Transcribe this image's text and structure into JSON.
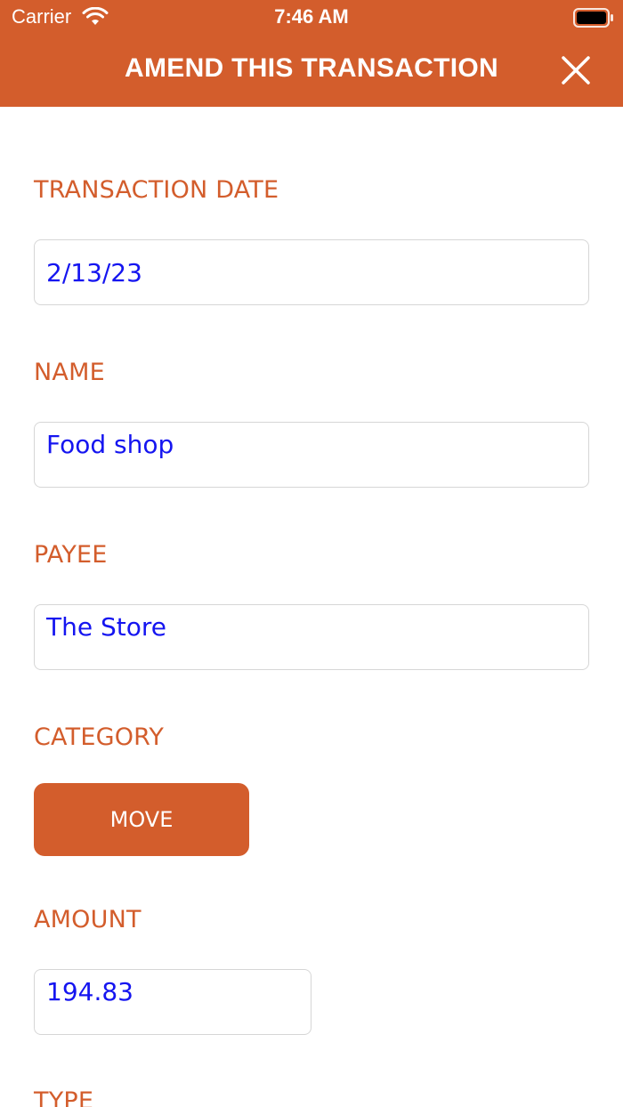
{
  "status_bar": {
    "carrier": "Carrier",
    "time": "7:46 AM"
  },
  "header": {
    "title": "AMEND THIS TRANSACTION",
    "close_icon": "close-icon"
  },
  "form": {
    "transaction_date": {
      "label": "TRANSACTION DATE",
      "value": "2/13/23"
    },
    "name": {
      "label": "NAME",
      "value": "Food shop"
    },
    "payee": {
      "label": "PAYEE",
      "value": "The Store"
    },
    "category": {
      "label": "CATEGORY",
      "button_label": "MOVE"
    },
    "amount": {
      "label": "AMOUNT",
      "value": "194.83"
    },
    "type": {
      "label": "TYPE"
    }
  },
  "colors": {
    "accent": "#D35D2C",
    "input_text": "#1515F0",
    "border": "#d6d6d6"
  }
}
